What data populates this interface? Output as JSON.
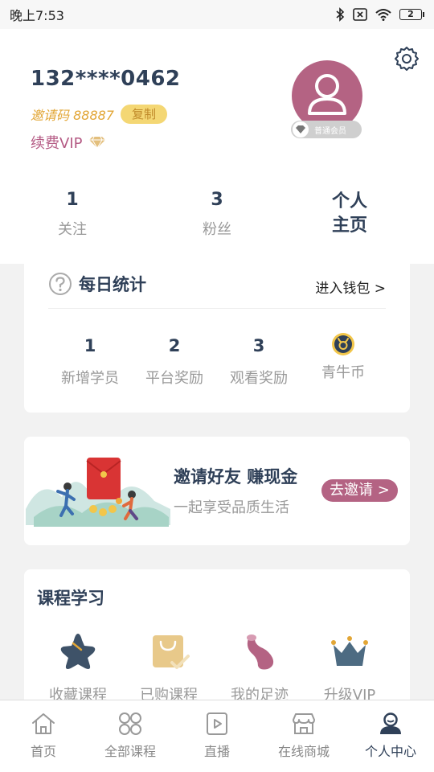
{
  "status": {
    "time": "晚上7:53",
    "battery": "2"
  },
  "profile": {
    "phone": "132****0462",
    "invite_code": "邀请码 88887",
    "copy_label": "复制",
    "vip_label": "续费VIP",
    "member_level": "普通会员"
  },
  "stats": [
    {
      "value": "1",
      "label": "关注"
    },
    {
      "value": "3",
      "label": "粉丝"
    }
  ],
  "home_link": {
    "line1": "个人",
    "line2": "主页"
  },
  "daily": {
    "title": "每日统计",
    "wallet_link": "进入钱包 >",
    "items": [
      {
        "value": "1",
        "label": "新增学员"
      },
      {
        "value": "2",
        "label": "平台奖励"
      },
      {
        "value": "3",
        "label": "观看奖励"
      },
      {
        "value": "",
        "label": "青牛币"
      }
    ]
  },
  "invite": {
    "title": "邀请好友 赚现金",
    "subtitle": "一起享受品质生活",
    "button": "去邀请 >"
  },
  "courses": {
    "title": "课程学习",
    "items": [
      {
        "label": "收藏课程",
        "icon": "star-icon"
      },
      {
        "label": "已购课程",
        "icon": "shopping-bag-icon"
      },
      {
        "label": "我的足迹",
        "icon": "footprint-icon"
      },
      {
        "label": "升级VIP",
        "icon": "crown-icon"
      }
    ]
  },
  "nav": {
    "items": [
      {
        "label": "首页",
        "icon": "home-icon"
      },
      {
        "label": "全部课程",
        "icon": "grid-icon"
      },
      {
        "label": "直播",
        "icon": "play-icon"
      },
      {
        "label": "在线商城",
        "icon": "shop-icon"
      },
      {
        "label": "个人中心",
        "icon": "person-icon"
      }
    ],
    "active": "个人中心"
  },
  "colors": {
    "navy": "#2f4058",
    "accent": "#b46383",
    "gold": "#e2a636"
  }
}
